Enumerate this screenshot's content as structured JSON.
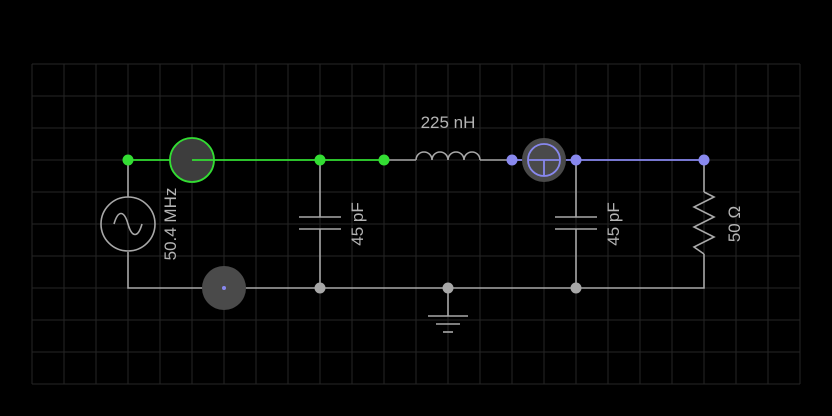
{
  "circuit": {
    "source": {
      "frequency_label": "50.4 MHz",
      "symbol": "ac-source-icon"
    },
    "inductor": {
      "label": "225 nH"
    },
    "capacitor_left": {
      "label": "45 pF"
    },
    "capacitor_right": {
      "label": "45 pF"
    },
    "resistor": {
      "label": "50 Ω"
    },
    "ground": {
      "symbol": "ground-icon"
    }
  },
  "colors": {
    "background": "#000000",
    "grid": "#262626",
    "wire_default": "#a8a8a8",
    "wire_active_green": "#33dd33",
    "wire_active_blue": "#8888ee",
    "probe_fill": "#4a4a4a"
  }
}
